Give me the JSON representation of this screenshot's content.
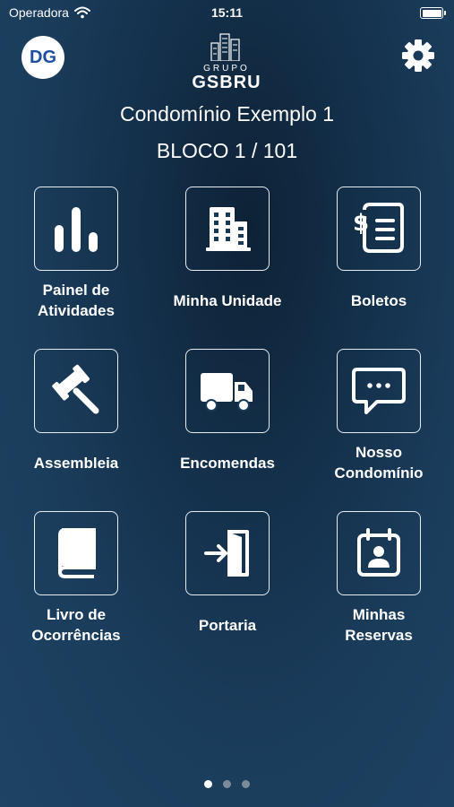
{
  "status": {
    "carrier": "Operadora",
    "time": "15:11"
  },
  "header": {
    "avatar_initials": "DG",
    "logo_top": "GRUPO",
    "logo_main": "GSBRU"
  },
  "condo": {
    "name": "Condomínio Exemplo 1",
    "unit": "BLOCO 1 / 101"
  },
  "menu": [
    {
      "label": "Painel de\nAtividades",
      "icon": "bar-chart-icon"
    },
    {
      "label": "Minha Unidade",
      "icon": "building-icon"
    },
    {
      "label": "Boletos",
      "icon": "invoice-icon"
    },
    {
      "label": "Assembleia",
      "icon": "gavel-icon"
    },
    {
      "label": "Encomendas",
      "icon": "truck-icon"
    },
    {
      "label": "Nosso\nCondomínio",
      "icon": "chat-icon"
    },
    {
      "label": "Livro de\nOcorrências",
      "icon": "book-icon"
    },
    {
      "label": "Portaria",
      "icon": "enter-door-icon"
    },
    {
      "label": "Minhas\nReservas",
      "icon": "calendar-person-icon"
    }
  ],
  "pager": {
    "total": 3,
    "current": 1
  }
}
